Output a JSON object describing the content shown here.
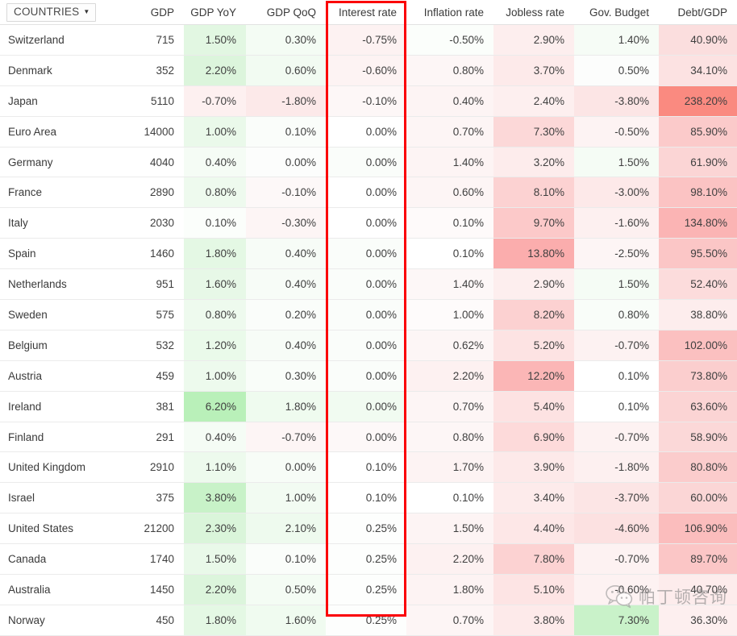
{
  "selector": {
    "label": "COUNTRIES",
    "caret_icon": "chevron-down-icon"
  },
  "table": {
    "columns": [
      "COUNTRIES",
      "GDP",
      "GDP YoY",
      "GDP QoQ",
      "Interest rate",
      "Inflation rate",
      "Jobless rate",
      "Gov. Budget",
      "Debt/GDP"
    ],
    "highlighted_column": "Interest rate",
    "rows": [
      {
        "country": "Switzerland",
        "gdp": "715",
        "gdp_yoy": "1.50%",
        "gdp_qoq": "0.30%",
        "interest_rate": "-0.75%",
        "inflation_rate": "-0.50%",
        "jobless_rate": "2.90%",
        "gov_budget": "1.40%",
        "debt_gdp": "40.90%",
        "bg": {
          "gdp_yoy": "#e2f7e2",
          "gdp_qoq": "#f4fcf4",
          "interest_rate": "#fdf2f2",
          "inflation_rate": "#fbfefb",
          "jobless_rate": "#fdeeee",
          "gov_budget": "#f6fcf6",
          "debt_gdp": "#fbdede"
        }
      },
      {
        "country": "Denmark",
        "gdp": "352",
        "gdp_yoy": "2.20%",
        "gdp_qoq": "0.60%",
        "interest_rate": "-0.60%",
        "inflation_rate": "0.80%",
        "jobless_rate": "3.70%",
        "gov_budget": "0.50%",
        "debt_gdp": "34.10%",
        "bg": {
          "gdp_yoy": "#dcf5dc",
          "gdp_qoq": "#f2fbf2",
          "interest_rate": "#fdf3f3",
          "inflation_rate": "#fdf6f6",
          "jobless_rate": "#fdeaea",
          "gov_budget": "#fcfdfc",
          "debt_gdp": "#fce2e2"
        }
      },
      {
        "country": "Japan",
        "gdp": "5110",
        "gdp_yoy": "-0.70%",
        "gdp_qoq": "-1.80%",
        "interest_rate": "-0.10%",
        "inflation_rate": "0.40%",
        "jobless_rate": "2.40%",
        "gov_budget": "-3.80%",
        "debt_gdp": "238.20%",
        "bg": {
          "gdp_yoy": "#fdf0f0",
          "gdp_qoq": "#fce9e9",
          "interest_rate": "#fdf7f7",
          "inflation_rate": "#fdf4f4",
          "jobless_rate": "#fdefef",
          "gov_budget": "#fce5e5",
          "debt_gdp": "#fa8a80"
        }
      },
      {
        "country": "Euro Area",
        "gdp": "14000",
        "gdp_yoy": "1.00%",
        "gdp_qoq": "0.10%",
        "interest_rate": "0.00%",
        "inflation_rate": "0.70%",
        "jobless_rate": "7.30%",
        "gov_budget": "-0.50%",
        "debt_gdp": "85.90%",
        "bg": {
          "gdp_yoy": "#eaf9ea",
          "gdp_qoq": "#fafdfa",
          "interest_rate": "#ffffff",
          "inflation_rate": "#fdf5f5",
          "jobless_rate": "#fcd8d8",
          "gov_budget": "#fdf3f3",
          "debt_gdp": "#fbcaca"
        }
      },
      {
        "country": "Germany",
        "gdp": "4040",
        "gdp_yoy": "0.40%",
        "gdp_qoq": "0.00%",
        "interest_rate": "0.00%",
        "inflation_rate": "1.40%",
        "jobless_rate": "3.20%",
        "gov_budget": "1.50%",
        "debt_gdp": "61.90%",
        "bg": {
          "gdp_yoy": "#f5fcf5",
          "gdp_qoq": "#fcfdfc",
          "interest_rate": "#fafdfa",
          "inflation_rate": "#fdf4f4",
          "jobless_rate": "#fdecec",
          "gov_budget": "#f5fcf5",
          "debt_gdp": "#fbd5d5"
        }
      },
      {
        "country": "France",
        "gdp": "2890",
        "gdp_yoy": "0.80%",
        "gdp_qoq": "-0.10%",
        "interest_rate": "0.00%",
        "inflation_rate": "0.60%",
        "jobless_rate": "8.10%",
        "gov_budget": "-3.00%",
        "debt_gdp": "98.10%",
        "bg": {
          "gdp_yoy": "#eefaee",
          "gdp_qoq": "#fdf8f8",
          "interest_rate": "#ffffff",
          "inflation_rate": "#fdf5f5",
          "jobless_rate": "#fcd2d2",
          "gov_budget": "#fde9e9",
          "debt_gdp": "#fbc3c3"
        }
      },
      {
        "country": "Italy",
        "gdp": "2030",
        "gdp_yoy": "0.10%",
        "gdp_qoq": "-0.30%",
        "interest_rate": "0.00%",
        "inflation_rate": "0.10%",
        "jobless_rate": "9.70%",
        "gov_budget": "-1.60%",
        "debt_gdp": "134.80%",
        "bg": {
          "gdp_yoy": "#fbfefb",
          "gdp_qoq": "#fdf5f5",
          "interest_rate": "#ffffff",
          "inflation_rate": "#fefafa",
          "jobless_rate": "#fcc9c9",
          "gov_budget": "#fdf0f0",
          "debt_gdp": "#fbb4b4"
        }
      },
      {
        "country": "Spain",
        "gdp": "1460",
        "gdp_yoy": "1.80%",
        "gdp_qoq": "0.40%",
        "interest_rate": "0.00%",
        "inflation_rate": "0.10%",
        "jobless_rate": "13.80%",
        "gov_budget": "-2.50%",
        "debt_gdp": "95.50%",
        "bg": {
          "gdp_yoy": "#e4f8e4",
          "gdp_qoq": "#f7fcf7",
          "interest_rate": "#fafdfa",
          "inflation_rate": "#ffffff",
          "jobless_rate": "#fbadad",
          "gov_budget": "#fdf5f5",
          "debt_gdp": "#fbc6c6"
        }
      },
      {
        "country": "Netherlands",
        "gdp": "951",
        "gdp_yoy": "1.60%",
        "gdp_qoq": "0.40%",
        "interest_rate": "0.00%",
        "inflation_rate": "1.40%",
        "jobless_rate": "2.90%",
        "gov_budget": "1.50%",
        "debt_gdp": "52.40%",
        "bg": {
          "gdp_yoy": "#e7f8e7",
          "gdp_qoq": "#f7fcf7",
          "interest_rate": "#fafdfa",
          "inflation_rate": "#fdf7f7",
          "jobless_rate": "#fdeeee",
          "gov_budget": "#f5fcf5",
          "debt_gdp": "#fcdcdc"
        }
      },
      {
        "country": "Sweden",
        "gdp": "575",
        "gdp_yoy": "0.80%",
        "gdp_qoq": "0.20%",
        "interest_rate": "0.00%",
        "inflation_rate": "1.00%",
        "jobless_rate": "8.20%",
        "gov_budget": "0.80%",
        "debt_gdp": "38.80%",
        "bg": {
          "gdp_yoy": "#eefaee",
          "gdp_qoq": "#fafdfa",
          "interest_rate": "#fafdfa",
          "inflation_rate": "#fefbfb",
          "jobless_rate": "#fcd1d1",
          "gov_budget": "#f9fdf9",
          "debt_gdp": "#fdeded"
        }
      },
      {
        "country": "Belgium",
        "gdp": "532",
        "gdp_yoy": "1.20%",
        "gdp_qoq": "0.40%",
        "interest_rate": "0.00%",
        "inflation_rate": "0.62%",
        "jobless_rate": "5.20%",
        "gov_budget": "-0.70%",
        "debt_gdp": "102.00%",
        "bg": {
          "gdp_yoy": "#eafaea",
          "gdp_qoq": "#f7fcf7",
          "interest_rate": "#fafdfa",
          "inflation_rate": "#fdf6f6",
          "jobless_rate": "#fde3e3",
          "gov_budget": "#fdf2f2",
          "debt_gdp": "#fbc0c0"
        }
      },
      {
        "country": "Austria",
        "gdp": "459",
        "gdp_yoy": "1.00%",
        "gdp_qoq": "0.30%",
        "interest_rate": "0.00%",
        "inflation_rate": "2.20%",
        "jobless_rate": "12.20%",
        "gov_budget": "0.10%",
        "debt_gdp": "73.80%",
        "bg": {
          "gdp_yoy": "#edfaed",
          "gdp_qoq": "#f9fdf9",
          "interest_rate": "#fafdfa",
          "inflation_rate": "#fdf1f1",
          "jobless_rate": "#fbb6b6",
          "gov_budget": "#ffffff",
          "debt_gdp": "#fbcece"
        }
      },
      {
        "country": "Ireland",
        "gdp": "381",
        "gdp_yoy": "6.20%",
        "gdp_qoq": "1.80%",
        "interest_rate": "0.00%",
        "inflation_rate": "0.70%",
        "jobless_rate": "5.40%",
        "gov_budget": "0.10%",
        "debt_gdp": "63.60%",
        "bg": {
          "gdp_yoy": "#b9f0b9",
          "gdp_qoq": "#effbef",
          "interest_rate": "#f1fbf1",
          "inflation_rate": "#fdf5f5",
          "jobless_rate": "#fde2e2",
          "gov_budget": "#ffffff",
          "debt_gdp": "#fbd4d4"
        }
      },
      {
        "country": "Finland",
        "gdp": "291",
        "gdp_yoy": "0.40%",
        "gdp_qoq": "-0.70%",
        "interest_rate": "0.00%",
        "inflation_rate": "0.80%",
        "jobless_rate": "6.90%",
        "gov_budget": "-0.70%",
        "debt_gdp": "58.90%",
        "bg": {
          "gdp_yoy": "#f5fcf5",
          "gdp_qoq": "#fdf5f5",
          "interest_rate": "#fdf8f8",
          "inflation_rate": "#fdf6f6",
          "jobless_rate": "#fddada",
          "gov_budget": "#fdf2f2",
          "debt_gdp": "#fbd8d8"
        }
      },
      {
        "country": "United Kingdom",
        "gdp": "2910",
        "gdp_yoy": "1.10%",
        "gdp_qoq": "0.00%",
        "interest_rate": "0.10%",
        "inflation_rate": "1.70%",
        "jobless_rate": "3.90%",
        "gov_budget": "-1.80%",
        "debt_gdp": "80.80%",
        "bg": {
          "gdp_yoy": "#edfaed",
          "gdp_qoq": "#f7fcf7",
          "interest_rate": "#ffffff",
          "inflation_rate": "#fdf3f3",
          "jobless_rate": "#fde9e9",
          "gov_budget": "#fdf0f0",
          "debt_gdp": "#fbcccc"
        }
      },
      {
        "country": "Israel",
        "gdp": "375",
        "gdp_yoy": "3.80%",
        "gdp_qoq": "1.00%",
        "interest_rate": "0.10%",
        "inflation_rate": "0.10%",
        "jobless_rate": "3.40%",
        "gov_budget": "-3.70%",
        "debt_gdp": "60.00%",
        "bg": {
          "gdp_yoy": "#c8f2c8",
          "gdp_qoq": "#f2fbf2",
          "interest_rate": "#ffffff",
          "inflation_rate": "#ffffff",
          "jobless_rate": "#fdebeb",
          "gov_budget": "#fce5e5",
          "debt_gdp": "#fbd6d6"
        }
      },
      {
        "country": "United States",
        "gdp": "21200",
        "gdp_yoy": "2.30%",
        "gdp_qoq": "2.10%",
        "interest_rate": "0.25%",
        "inflation_rate": "1.50%",
        "jobless_rate": "4.40%",
        "gov_budget": "-4.60%",
        "debt_gdp": "106.90%",
        "bg": {
          "gdp_yoy": "#daf5da",
          "gdp_qoq": "#eefaee",
          "interest_rate": "#fdfefd",
          "inflation_rate": "#fdf4f4",
          "jobless_rate": "#fde7e7",
          "gov_budget": "#fce1e1",
          "debt_gdp": "#fbbdbd"
        }
      },
      {
        "country": "Canada",
        "gdp": "1740",
        "gdp_yoy": "1.50%",
        "gdp_qoq": "0.10%",
        "interest_rate": "0.25%",
        "inflation_rate": "2.20%",
        "jobless_rate": "7.80%",
        "gov_budget": "-0.70%",
        "debt_gdp": "89.70%",
        "bg": {
          "gdp_yoy": "#e9f9e9",
          "gdp_qoq": "#fafdfa",
          "interest_rate": "#fdfefd",
          "inflation_rate": "#fdf1f1",
          "jobless_rate": "#fcd2d2",
          "gov_budget": "#fdf2f2",
          "debt_gdp": "#fbc6c6"
        }
      },
      {
        "country": "Australia",
        "gdp": "1450",
        "gdp_yoy": "2.20%",
        "gdp_qoq": "0.50%",
        "interest_rate": "0.25%",
        "inflation_rate": "1.80%",
        "jobless_rate": "5.10%",
        "gov_budget": "-0.60%",
        "debt_gdp": "40.70%",
        "bg": {
          "gdp_yoy": "#dcf5dc",
          "gdp_qoq": "#f4fcf4",
          "interest_rate": "#fdfefd",
          "inflation_rate": "#fdf3f3",
          "jobless_rate": "#fde4e4",
          "gov_budget": "#fdf2f2",
          "debt_gdp": "#fdecec"
        }
      },
      {
        "country": "Norway",
        "gdp": "450",
        "gdp_yoy": "1.80%",
        "gdp_qoq": "1.60%",
        "interest_rate": "0.25%",
        "inflation_rate": "0.70%",
        "jobless_rate": "3.80%",
        "gov_budget": "7.30%",
        "debt_gdp": "36.30%",
        "bg": {
          "gdp_yoy": "#e4f8e4",
          "gdp_qoq": "#f0fbf0",
          "interest_rate": "#fdfefd",
          "inflation_rate": "#fdf5f5",
          "jobless_rate": "#fdeaea",
          "gov_budget": "#c9f2c9",
          "debt_gdp": "#fdefef"
        }
      }
    ]
  },
  "watermark": {
    "text": "帕丁顿咨询",
    "logo_icon": "wechat-icon"
  },
  "colors": {
    "highlight_border": "#fb0007",
    "positive": "#b9f0b9",
    "negative": "#fa8a80"
  }
}
